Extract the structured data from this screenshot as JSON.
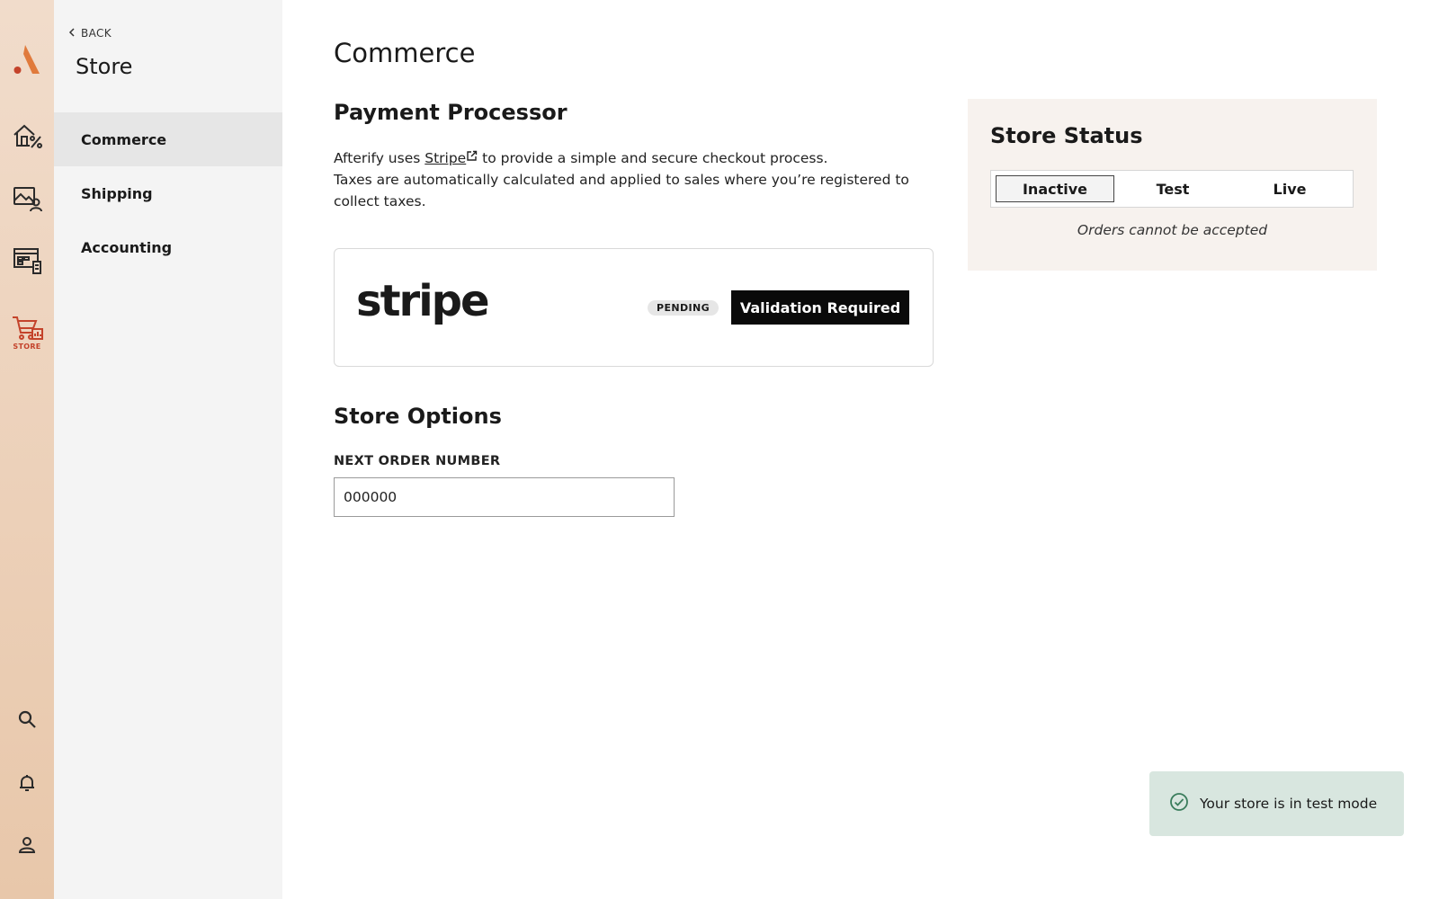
{
  "rail": {
    "logo_icon": "afterify-logo",
    "items": [
      {
        "icon": "house-percent-icon"
      },
      {
        "icon": "gallery-user-icon"
      },
      {
        "icon": "forms-icon"
      },
      {
        "icon": "cart-chart-icon",
        "label": "STORE",
        "active": true
      }
    ],
    "bottom": [
      {
        "icon": "search-icon"
      },
      {
        "icon": "bell-icon"
      },
      {
        "icon": "user-icon"
      }
    ],
    "accent": "#c4432b"
  },
  "subnav": {
    "back_label": "BACK",
    "title": "Store",
    "items": [
      {
        "label": "Commerce",
        "active": true
      },
      {
        "label": "Shipping"
      },
      {
        "label": "Accounting"
      }
    ]
  },
  "main": {
    "title": "Commerce",
    "payment": {
      "title": "Payment Processor",
      "desc_before": "Afterify uses ",
      "desc_link": "Stripe",
      "desc_after": " to provide a simple and secure checkout process.",
      "desc_line2": "Taxes are automatically calculated and applied to sales where you’re registered to collect taxes.",
      "provider_logo": "stripe",
      "status_badge": "PENDING",
      "action_label": "Validation Required"
    },
    "options": {
      "title": "Store Options",
      "next_order_label": "NEXT ORDER NUMBER",
      "next_order_value": "000000"
    }
  },
  "store_status": {
    "title": "Store Status",
    "options": [
      "Inactive",
      "Test",
      "Live"
    ],
    "selected": "Inactive",
    "note": "Orders cannot be accepted"
  },
  "toast": {
    "icon": "check-circle-icon",
    "message": "Your store is in test mode",
    "color": "#d8e6df"
  }
}
